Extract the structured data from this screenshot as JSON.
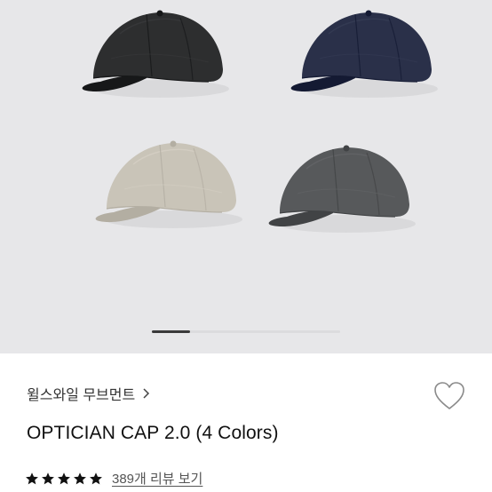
{
  "gallery": {
    "caps": [
      {
        "color": "#2d2e2f",
        "name": "black"
      },
      {
        "color": "#2a3049",
        "name": "navy"
      },
      {
        "color": "#c9c4b8",
        "name": "beige"
      },
      {
        "color": "#57595b",
        "name": "charcoal"
      }
    ],
    "pager": {
      "active_index": 0,
      "count": 5
    }
  },
  "product": {
    "brand": "윌스와일 무브먼트",
    "brand_chevron_icon": "chevron-right-icon",
    "wishlist_icon": "heart-outline-icon",
    "title": "OPTICIAN CAP 2.0 (4 Colors)",
    "rating": 5,
    "rating_star_color": "#111111",
    "review_link": "389개 리뷰 보기"
  }
}
